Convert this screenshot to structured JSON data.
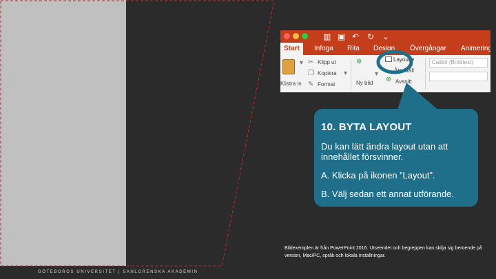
{
  "ribbon": {
    "tabs": [
      "Start",
      "Infoga",
      "Rita",
      "Design",
      "Övergångar",
      "Animering"
    ],
    "active_tab": "Start",
    "paste_label": "Klistra in",
    "cut_label": "Klipp ut",
    "copy_label": "Kopiera",
    "format_label": "Format",
    "new_slide_label": "Ny bild",
    "layout_label": "Layout",
    "reset_label": "Återställ",
    "section_label": "Avsnitt",
    "font_placeholder": "Calibri (Brödtext)",
    "accent_color": "#c43e1c"
  },
  "callout": {
    "title": "10. BYTA LAYOUT",
    "body": "Du kan lätt ändra layout utan att innehållet försvinner.",
    "step_a": "A. Klicka på ikonen ”Layout”.",
    "step_b": "B. Välj sedan ett annat utförande.",
    "color": "#1f6f8b"
  },
  "footnote": "Bildexemplen är från PowerPoint 2016. Utseendet och begreppen kan skilja sig beroende på version, Mac/PC, språk och lokala inställningar.",
  "footer": "GÖTEBORGS UNIVERSITET  |  SAHLGRENSKA AKADEMIN"
}
